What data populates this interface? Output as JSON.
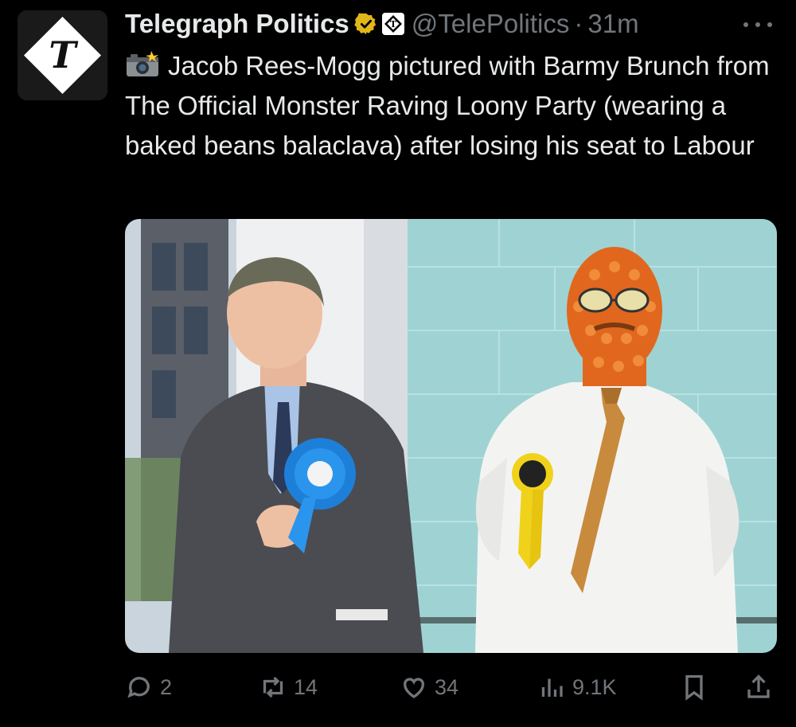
{
  "author": {
    "display_name": "Telegraph Politics",
    "handle": "@TelePolitics",
    "separator": "·",
    "time": "31m",
    "avatar_letter": "T"
  },
  "tweet": {
    "emoji": "camera-flash",
    "text": "Jacob Rees-Mogg pictured with Barmy Brunch from The Official Monster Raving Loony Party (wearing a baked beans balaclava) after losing his seat to Labour"
  },
  "media": {
    "description": "photo"
  },
  "actions": {
    "replies": "2",
    "reposts": "14",
    "likes": "34",
    "views": "9.1K"
  },
  "colors": {
    "background": "#000000",
    "text": "#e7e9ea",
    "muted": "#71767b",
    "verified_gold": "#e2b719"
  }
}
